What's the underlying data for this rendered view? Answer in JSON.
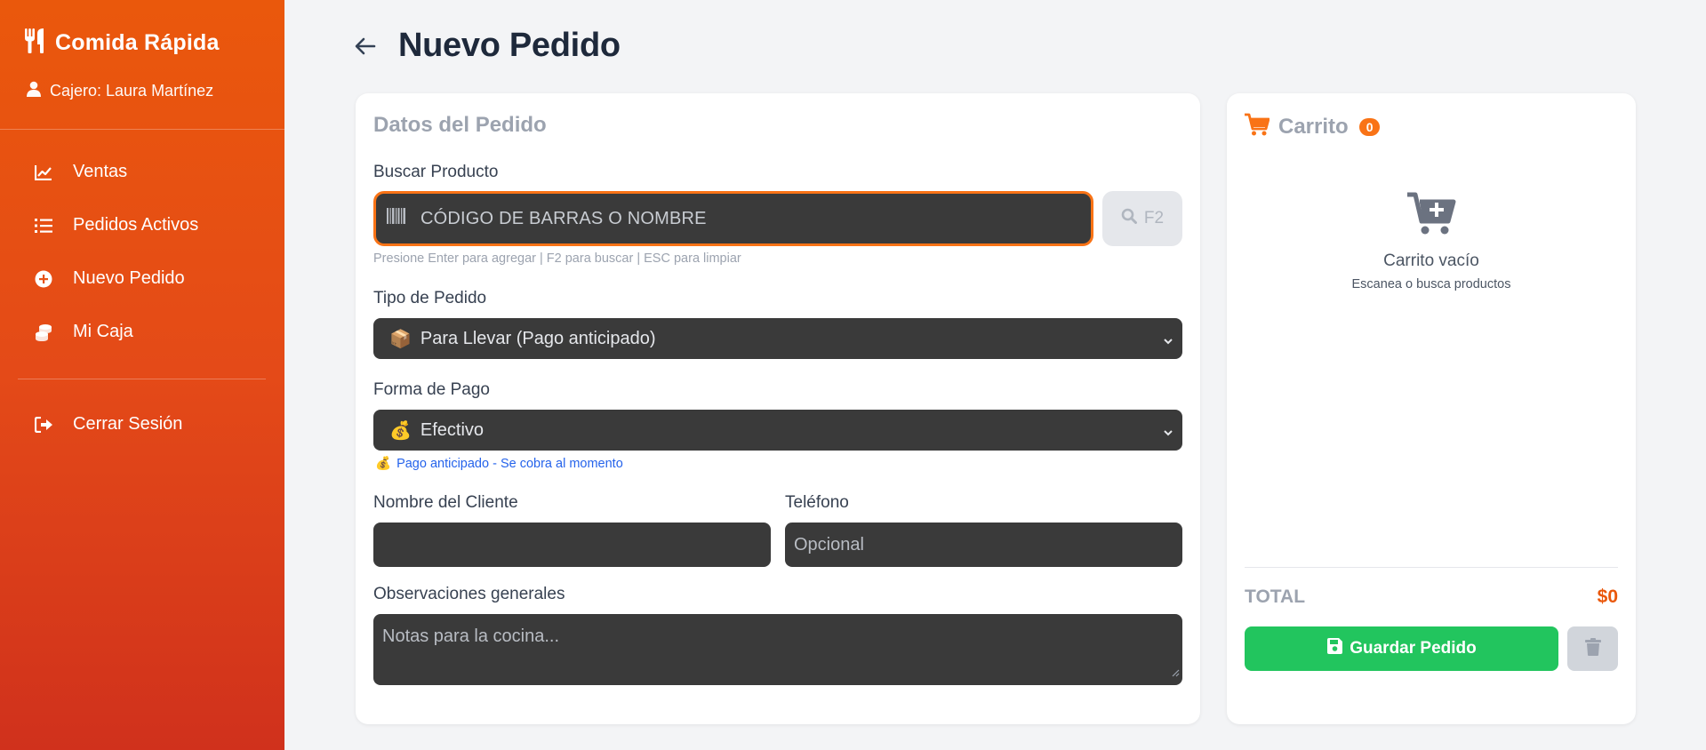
{
  "app": {
    "brand": "Comida Rápida",
    "cashier": "Cajero: Laura Martínez"
  },
  "sidebar": {
    "items": [
      {
        "label": "Ventas",
        "icon": "chart-line-icon"
      },
      {
        "label": "Pedidos Activos",
        "icon": "list-icon"
      },
      {
        "label": "Nuevo Pedido",
        "icon": "plus-circle-icon"
      },
      {
        "label": "Mi Caja",
        "icon": "coins-icon"
      }
    ],
    "logout": {
      "label": "Cerrar Sesión",
      "icon": "logout-icon"
    }
  },
  "header": {
    "title": "Nuevo Pedido",
    "back_icon": "arrow-left-icon"
  },
  "order": {
    "card_title": "Datos del Pedido",
    "search": {
      "label": "Buscar Producto",
      "placeholder": "CÓDIGO DE BARRAS O NOMBRE",
      "button_label": "F2",
      "hint": "Presione Enter para agregar | F2 para buscar | ESC para limpiar"
    },
    "order_type": {
      "label": "Tipo de Pedido",
      "selected_emoji": "📦",
      "selected": "Para Llevar (Pago anticipado)"
    },
    "payment": {
      "label": "Forma de Pago",
      "selected_emoji": "💰",
      "selected": "Efectivo",
      "note_emoji": "💰",
      "note": "Pago anticipado - Se cobra al momento"
    },
    "customer_name": {
      "label": "Nombre del Cliente",
      "value": ""
    },
    "phone": {
      "label": "Teléfono",
      "placeholder": "Opcional"
    },
    "notes": {
      "label": "Observaciones generales",
      "placeholder": "Notas para la cocina..."
    }
  },
  "cart": {
    "title": "Carrito",
    "count": "0",
    "empty_title": "Carrito vacío",
    "empty_subtitle": "Escanea o busca productos",
    "total_label": "TOTAL",
    "total_value": "$0",
    "save_label": "Guardar Pedido"
  },
  "colors": {
    "accent": "#f97316",
    "sidebar_top": "#ea580c",
    "sidebar_bottom": "#d0311c",
    "success": "#22c55e",
    "field_bg": "#3a3a3a"
  }
}
